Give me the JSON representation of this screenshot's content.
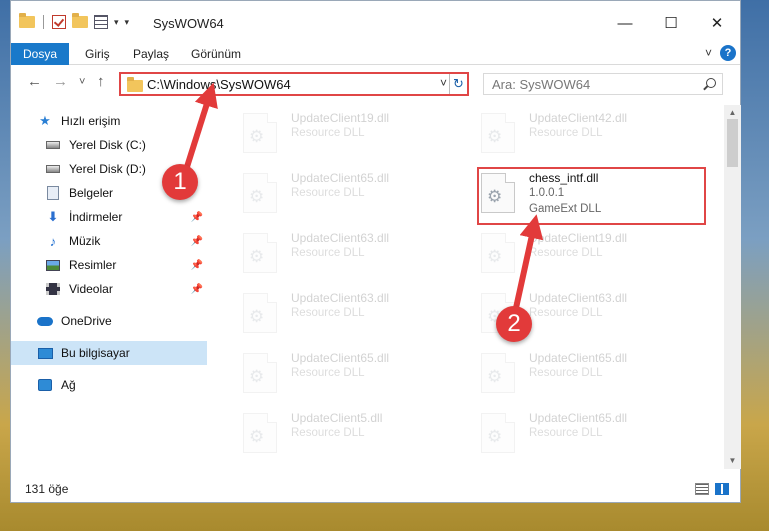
{
  "window": {
    "title": "SysWOW64",
    "controls": {
      "minimize": "—",
      "maximize": "☐",
      "close": "✕"
    }
  },
  "ribbon": {
    "tabs": [
      "Dosya",
      "Giriş",
      "Paylaş",
      "Görünüm"
    ],
    "help": "?"
  },
  "nav": {
    "back": "←",
    "forward": "→",
    "recent": "˅",
    "up": "↑",
    "address": "C:\\Windows\\SysWOW64",
    "refresh": "↻",
    "search_placeholder": "Ara: SysWOW64"
  },
  "sidebar": {
    "items": [
      {
        "label": "Hızlı erişim",
        "icon": "star-icon"
      },
      {
        "label": "Yerel Disk (C:)",
        "icon": "disk-icon"
      },
      {
        "label": "Yerel Disk (D:)",
        "icon": "disk-icon"
      },
      {
        "label": "Belgeler",
        "icon": "documents-icon"
      },
      {
        "label": "İndirmeler",
        "icon": "downloads-icon"
      },
      {
        "label": "Müzik",
        "icon": "music-icon"
      },
      {
        "label": "Resimler",
        "icon": "pictures-icon"
      },
      {
        "label": "Videolar",
        "icon": "videos-icon"
      },
      {
        "label": "OneDrive",
        "icon": "cloud-icon"
      },
      {
        "label": "Bu bilgisayar",
        "icon": "computer-icon"
      },
      {
        "label": "Ağ",
        "icon": "network-icon"
      }
    ]
  },
  "files": {
    "left": [
      {
        "name": "UpdateClient19.dll",
        "type": "Resource DLL"
      },
      {
        "name": "UpdateClient65.dll",
        "type": "Resource DLL"
      },
      {
        "name": "UpdateClient63.dll",
        "type": "Resource DLL"
      },
      {
        "name": "UpdateClient63.dll",
        "type": "Resource DLL"
      },
      {
        "name": "UpdateClient65.dll",
        "type": "Resource DLL"
      },
      {
        "name": "UpdateClient5.dll",
        "type": "Resource DLL"
      }
    ],
    "right": [
      {
        "name": "UpdateClient42.dll",
        "type": "Resource DLL"
      },
      {
        "name": "chess_intf.dll",
        "version": "1.0.0.1",
        "type": "GameExt DLL",
        "highlighted": true
      },
      {
        "name": "UpdateClient19.dll",
        "type": "Resource DLL"
      },
      {
        "name": "UpdateClient63.dll",
        "type": "Resource DLL"
      },
      {
        "name": "UpdateClient65.dll",
        "type": "Resource DLL"
      },
      {
        "name": "UpdateClient65.dll",
        "type": "Resource DLL"
      }
    ]
  },
  "status": {
    "count": "131 öğe"
  },
  "annotations": {
    "step1": "1",
    "step2": "2",
    "color": "#e23a3a"
  }
}
